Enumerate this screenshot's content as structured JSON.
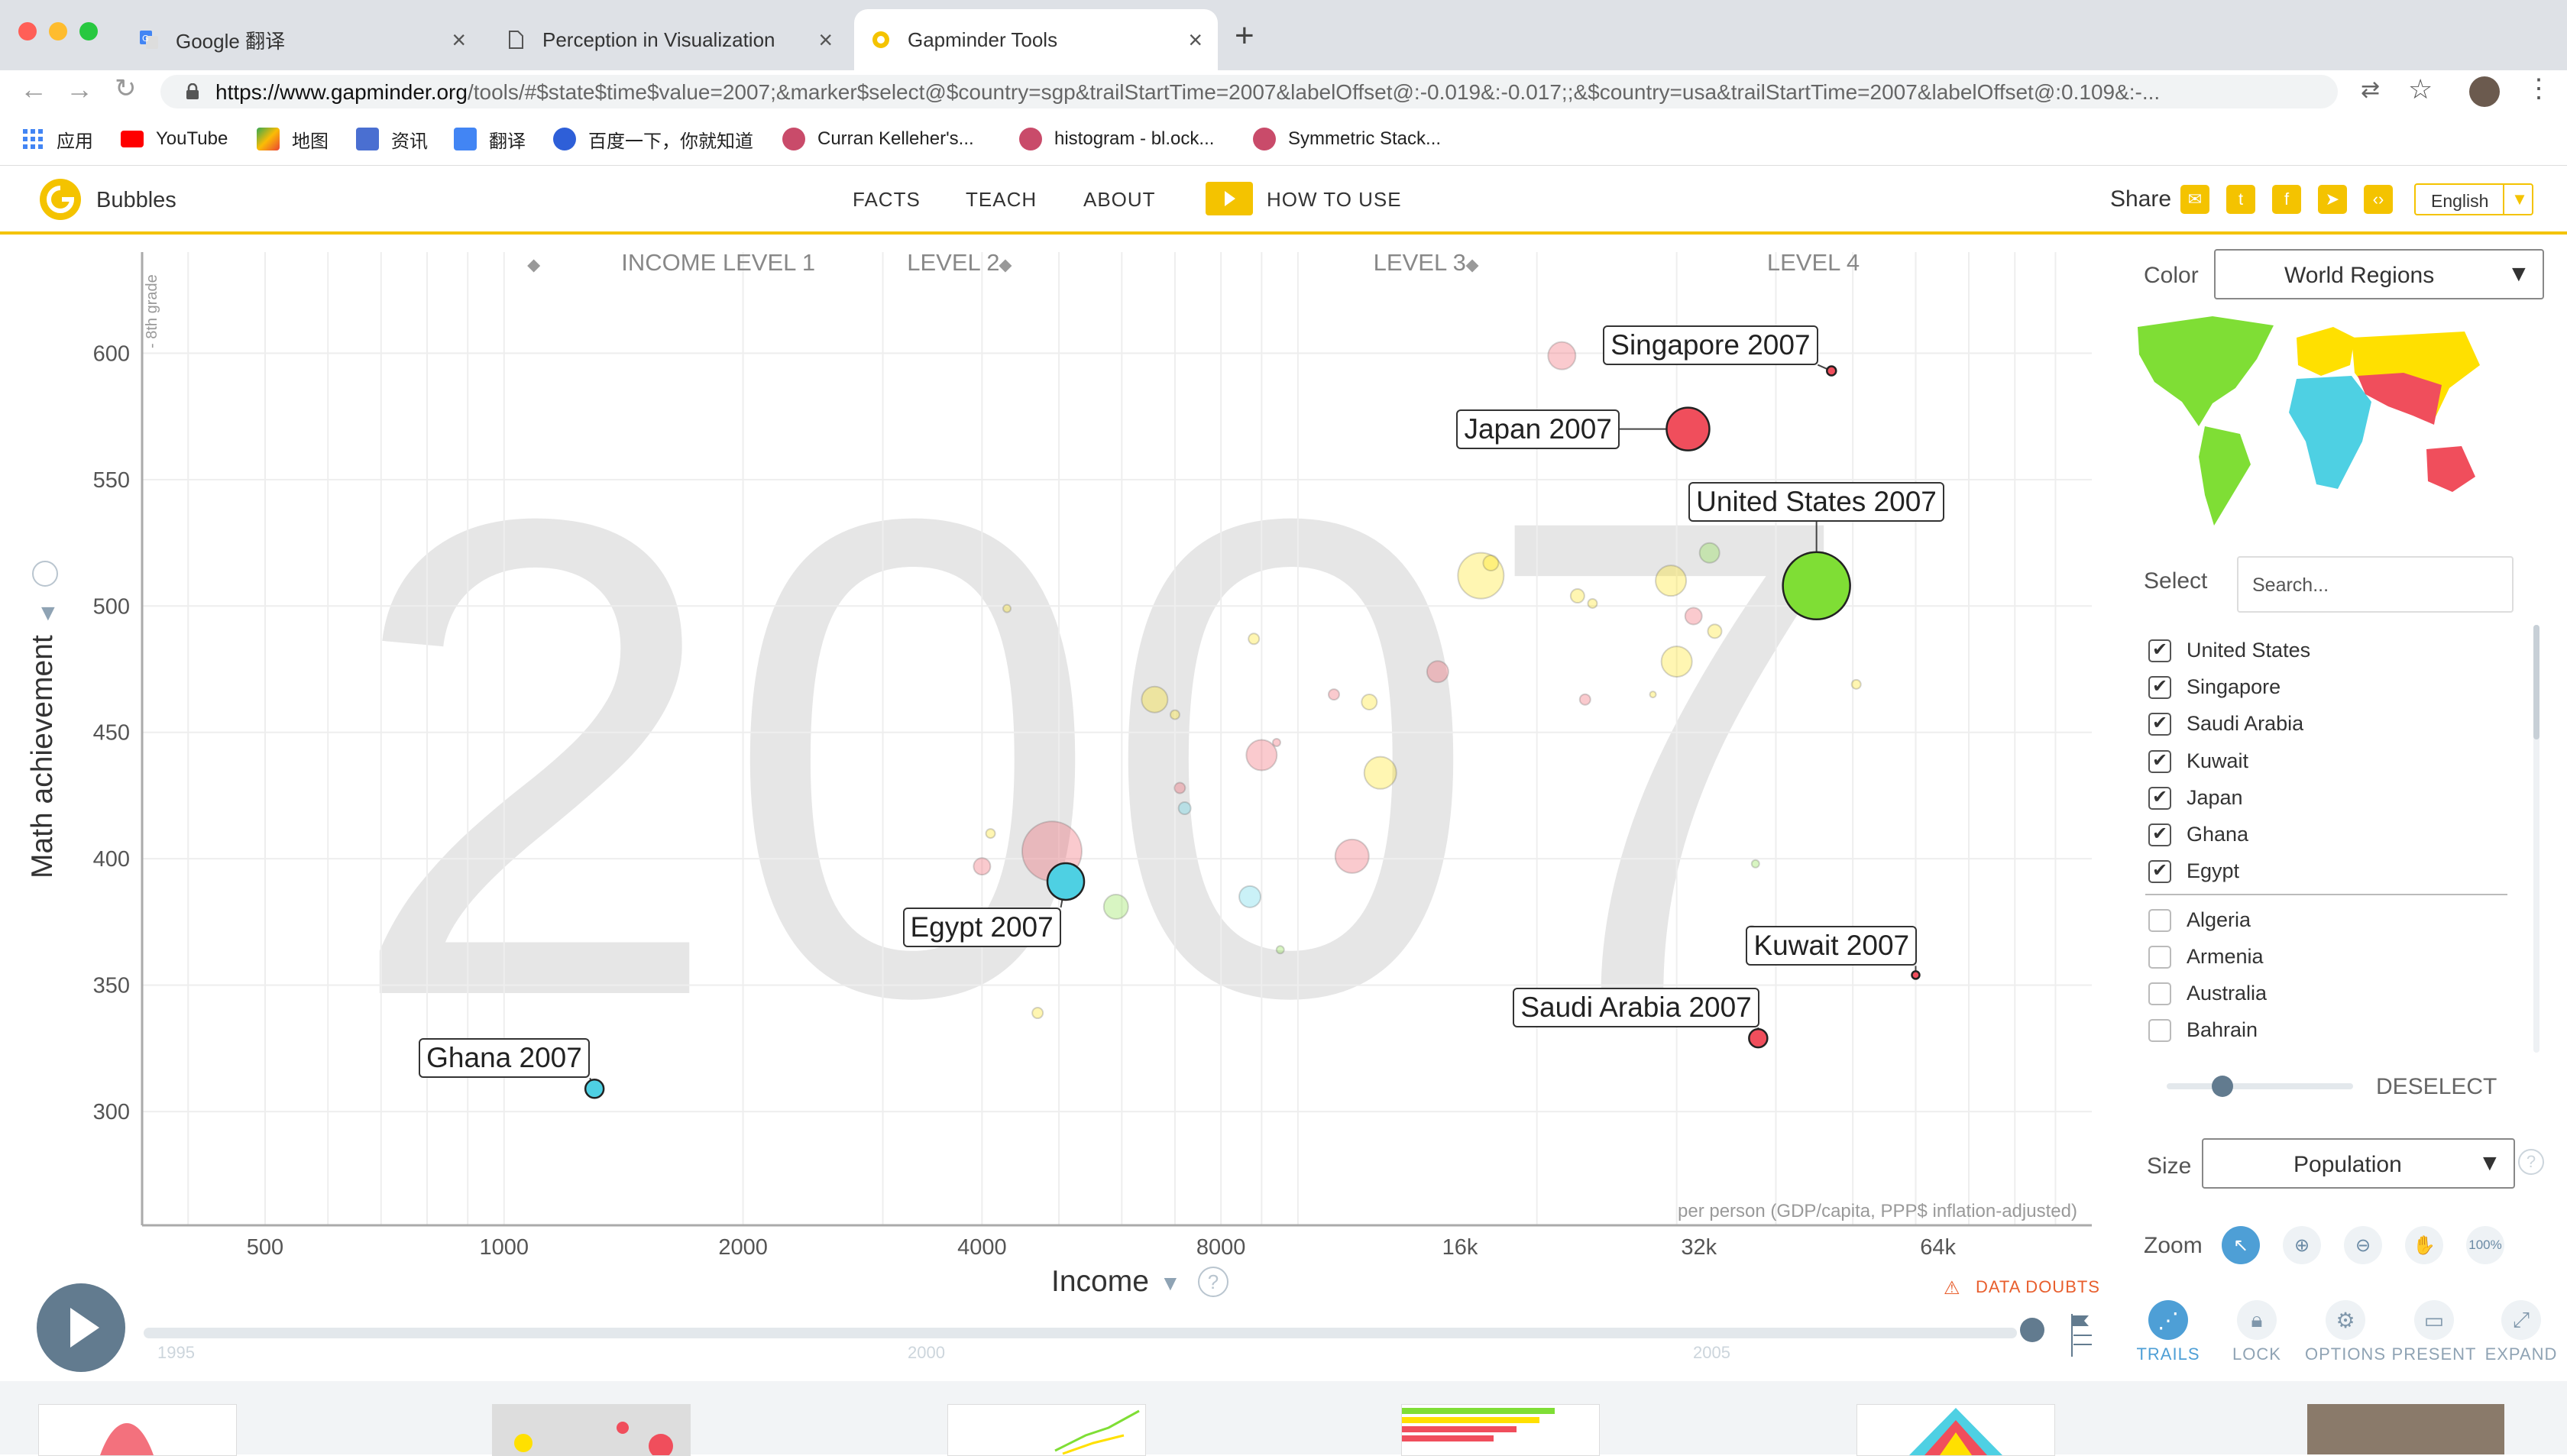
{
  "browser": {
    "tabs": [
      {
        "title": "Google 翻译"
      },
      {
        "title": "Perception in Visualization"
      },
      {
        "title": "Gapminder Tools"
      }
    ],
    "url_prefix": "https://www.gapminder.org",
    "url_rest": "/tools/#$state$time$value=2007;&marker$select@$country=sgp&trailStartTime=2007&labelOffset@:-0.019&:-0.017;;&$country=usa&trailStartTime=2007&labelOffset@:0.109&:-...",
    "bookmarks": [
      "应用",
      "YouTube",
      "地图",
      "资讯",
      "翻译",
      "百度一下，你就知道",
      "Curran Kelleher's...",
      "histogram - bl.ock...",
      "Symmetric Stack..."
    ]
  },
  "app": {
    "logo": "Bubbles",
    "nav": [
      "FACTS",
      "TEACH",
      "ABOUT",
      "HOW TO USE"
    ],
    "share": "Share",
    "language": "English"
  },
  "chart_data": {
    "type": "scatter",
    "year_watermark": "2007",
    "xlabel": "Income",
    "xunit": "per person (GDP/capita, PPP$ inflation-adjusted)",
    "ylabel": "Math achievement",
    "ylabel_note": "- 8th grade",
    "x_scale": "log",
    "xlim": [
      350,
      100000
    ],
    "ylim": [
      255,
      640
    ],
    "xticks": [
      500,
      1000,
      2000,
      4000,
      8000,
      16000,
      32000,
      64000
    ],
    "xtick_labels": [
      "500",
      "1000",
      "2000",
      "4000",
      "8000",
      "16k",
      "32k",
      "64k"
    ],
    "yticks": [
      300,
      350,
      400,
      450,
      500,
      550,
      600
    ],
    "income_levels": [
      "INCOME LEVEL 1",
      "LEVEL 2",
      "LEVEL 3",
      "LEVEL 4"
    ],
    "legend_colors": {
      "africa": "#4ed0e3",
      "americas": "#7fde35",
      "asia": "#f04e5c",
      "europe": "#ffe000"
    },
    "selected": [
      {
        "label": "Singapore 2007",
        "x": 47000,
        "y": 593,
        "r": 6,
        "color": "#f04e5c"
      },
      {
        "label": "Japan 2007",
        "x": 31000,
        "y": 570,
        "r": 28,
        "color": "#f04e5c"
      },
      {
        "label": "United States 2007",
        "x": 45000,
        "y": 508,
        "r": 44,
        "color": "#7fde35"
      },
      {
        "label": "Egypt 2007",
        "x": 5100,
        "y": 391,
        "r": 24,
        "color": "#4ed0e3"
      },
      {
        "label": "Ghana 2007",
        "x": 1300,
        "y": 309,
        "r": 12,
        "color": "#4ed0e3"
      },
      {
        "label": "Saudi Arabia 2007",
        "x": 38000,
        "y": 329,
        "r": 12,
        "color": "#f04e5c"
      },
      {
        "label": "Kuwait 2007",
        "x": 60000,
        "y": 354,
        "r": 5,
        "color": "#f04e5c"
      }
    ],
    "others": [
      {
        "x": 21500,
        "y": 599,
        "r": 18,
        "color": "#f04e5c"
      },
      {
        "x": 17000,
        "y": 512,
        "r": 30,
        "color": "#ffe000"
      },
      {
        "x": 17500,
        "y": 517,
        "r": 10,
        "color": "#ffe000"
      },
      {
        "x": 22500,
        "y": 504,
        "r": 9,
        "color": "#ffe000"
      },
      {
        "x": 23500,
        "y": 501,
        "r": 6,
        "color": "#ffe000"
      },
      {
        "x": 29500,
        "y": 510,
        "r": 20,
        "color": "#ffe000"
      },
      {
        "x": 33000,
        "y": 521,
        "r": 13,
        "color": "#7fde35"
      },
      {
        "x": 31500,
        "y": 496,
        "r": 11,
        "color": "#f04e5c"
      },
      {
        "x": 33500,
        "y": 490,
        "r": 9,
        "color": "#ffe000"
      },
      {
        "x": 30000,
        "y": 478,
        "r": 20,
        "color": "#ffe000"
      },
      {
        "x": 15000,
        "y": 474,
        "r": 14,
        "color": "#f04e5c"
      },
      {
        "x": 23000,
        "y": 463,
        "r": 7,
        "color": "#f04e5c"
      },
      {
        "x": 6600,
        "y": 463,
        "r": 17,
        "color": "#ffe000"
      },
      {
        "x": 7000,
        "y": 457,
        "r": 6,
        "color": "#ffe000"
      },
      {
        "x": 8800,
        "y": 487,
        "r": 7,
        "color": "#ffe000"
      },
      {
        "x": 11100,
        "y": 465,
        "r": 7,
        "color": "#f04e5c"
      },
      {
        "x": 12300,
        "y": 462,
        "r": 10,
        "color": "#ffe000"
      },
      {
        "x": 9000,
        "y": 441,
        "r": 20,
        "color": "#f04e5c"
      },
      {
        "x": 9400,
        "y": 446,
        "r": 5,
        "color": "#f04e5c"
      },
      {
        "x": 12700,
        "y": 434,
        "r": 21,
        "color": "#ffe000"
      },
      {
        "x": 7100,
        "y": 428,
        "r": 7,
        "color": "#f04e5c"
      },
      {
        "x": 7200,
        "y": 420,
        "r": 8,
        "color": "#4ed0e3"
      },
      {
        "x": 4900,
        "y": 403,
        "r": 39,
        "color": "#f04e5c"
      },
      {
        "x": 11700,
        "y": 401,
        "r": 22,
        "color": "#f04e5c"
      },
      {
        "x": 4000,
        "y": 397,
        "r": 11,
        "color": "#f04e5c"
      },
      {
        "x": 4100,
        "y": 410,
        "r": 6,
        "color": "#ffe000"
      },
      {
        "x": 5900,
        "y": 381,
        "r": 16,
        "color": "#7fde35"
      },
      {
        "x": 8700,
        "y": 385,
        "r": 14,
        "color": "#4ed0e3"
      },
      {
        "x": 9500,
        "y": 364,
        "r": 5,
        "color": "#7fde35"
      },
      {
        "x": 4300,
        "y": 499,
        "r": 5,
        "color": "#ffe000"
      },
      {
        "x": 4700,
        "y": 339,
        "r": 7,
        "color": "#ffe000"
      },
      {
        "x": 28000,
        "y": 465,
        "r": 4,
        "color": "#ffe000"
      },
      {
        "x": 50500,
        "y": 469,
        "r": 6,
        "color": "#ffe000"
      },
      {
        "x": 37700,
        "y": 398,
        "r": 5,
        "color": "#7fde35"
      },
      {
        "x": 37300,
        "y": 372,
        "r": 5,
        "color": "#f04e5c"
      }
    ]
  },
  "timeline": {
    "year_labels": [
      "1995",
      "2000",
      "2005"
    ]
  },
  "panel": {
    "color_label": "Color",
    "color_value": "World Regions",
    "select_label": "Select",
    "search_placeholder": "Search...",
    "selected_countries": [
      "United States",
      "Singapore",
      "Saudi Arabia",
      "Kuwait",
      "Japan",
      "Ghana",
      "Egypt"
    ],
    "other_countries": [
      "Algeria",
      "Armenia",
      "Australia",
      "Bahrain"
    ],
    "deselect": "DESELECT",
    "opacity_level": 0.3,
    "size_label": "Size",
    "size_value": "Population",
    "zoom_label": "Zoom",
    "zoom_100": "100%",
    "data_doubts": "DATA DOUBTS",
    "bottom_buttons": [
      "TRAILS",
      "LOCK",
      "OPTIONS",
      "PRESENT",
      "EXPAND"
    ]
  }
}
